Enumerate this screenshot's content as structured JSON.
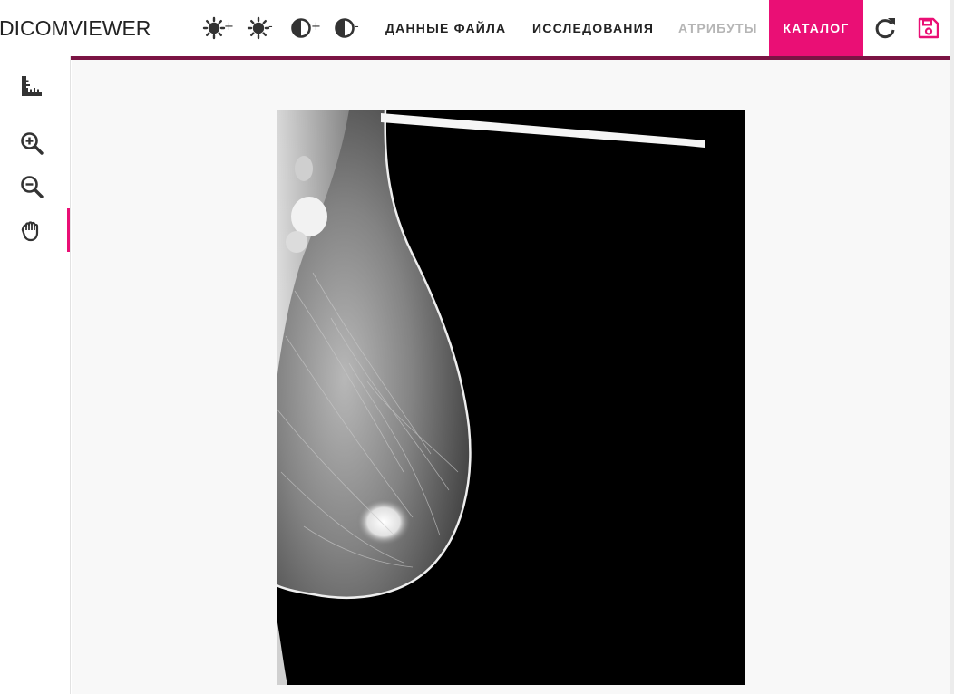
{
  "app": {
    "logo_part1": "DICOM",
    "logo_part2": "VIEWER"
  },
  "toolbar": {
    "brightness_up": {
      "icon": "brightness-up-icon",
      "sign": "+"
    },
    "brightness_down": {
      "icon": "brightness-down-icon",
      "sign": "-"
    },
    "contrast_up": {
      "icon": "contrast-up-icon",
      "sign": "+"
    },
    "contrast_down": {
      "icon": "contrast-down-icon",
      "sign": "-"
    },
    "refresh": {
      "icon": "refresh-icon"
    },
    "save": {
      "icon": "save-icon"
    }
  },
  "tabs": [
    {
      "label": "ДАННЫЕ ФАЙЛА",
      "state": "normal"
    },
    {
      "label": "ИССЛЕДОВАНИЯ",
      "state": "normal"
    },
    {
      "label": "АТРИБУТЫ",
      "state": "disabled"
    },
    {
      "label": "КАТАЛОГ",
      "state": "active"
    }
  ],
  "sidebar": {
    "tools": [
      {
        "icon": "ruler-icon"
      },
      {
        "icon": "zoom-in-icon"
      },
      {
        "icon": "zoom-out-icon"
      },
      {
        "icon": "pan-hand-icon",
        "active": true
      }
    ]
  },
  "colors": {
    "accent": "#ea0f75",
    "accent_dark": "#7b1444",
    "viewport_bg": "#f8f8f8",
    "disabled_text": "#b5b5b5"
  },
  "viewer": {
    "image_description_icon": "mammogram-image"
  }
}
